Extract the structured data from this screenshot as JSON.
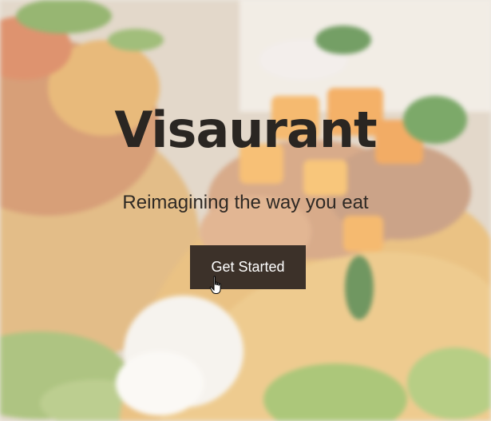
{
  "hero": {
    "title": "Visaurant",
    "tagline": "Reimagining the way you eat",
    "cta_label": "Get Started",
    "background_image": "tacos-food-photo",
    "cursor_icon": "hand-pointer-icon"
  },
  "colors": {
    "title": "#2a2622",
    "button_bg": "#3c3129",
    "button_text": "#ffffff"
  }
}
